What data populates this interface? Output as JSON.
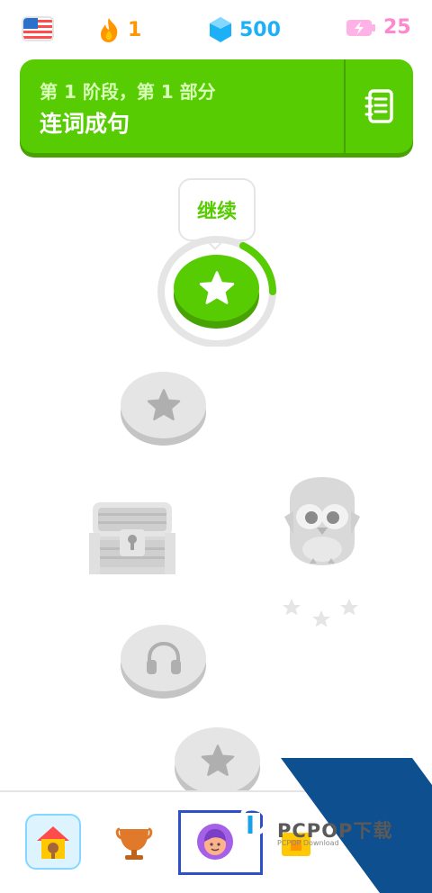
{
  "stats": {
    "flag_icon": "us-flag-icon",
    "streak": "1",
    "gems": "500",
    "energy": "25"
  },
  "unit": {
    "subtitle": "第 1 阶段，第 1 部分",
    "title": "连词成句"
  },
  "path": {
    "tooltip": "继续"
  },
  "colors": {
    "primary_green": "#58cc02",
    "dark_green": "#46a302",
    "streak_orange": "#ff9600",
    "gem_blue": "#1cb0f6",
    "energy_pink": "#ff86d0",
    "locked_gray": "#e5e5e5"
  },
  "watermark": {
    "brand": "PCPOP下载",
    "sub": "PCPOP Download"
  }
}
